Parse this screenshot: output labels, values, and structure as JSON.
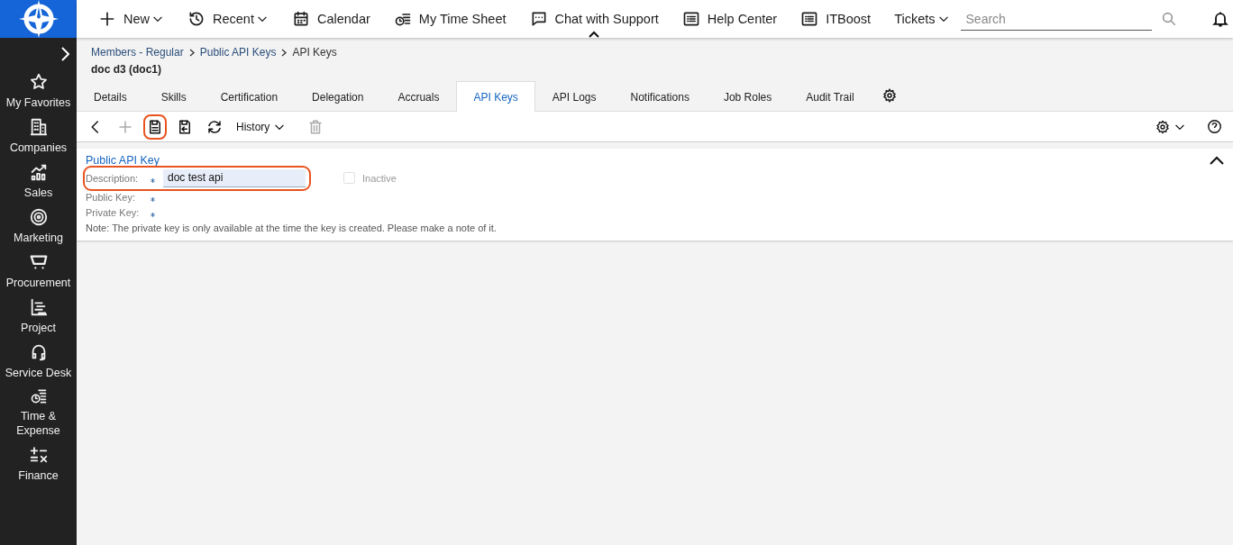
{
  "sidebar": {
    "items": [
      {
        "label": "My Favorites"
      },
      {
        "label": "Companies"
      },
      {
        "label": "Sales"
      },
      {
        "label": "Marketing"
      },
      {
        "label": "Procurement"
      },
      {
        "label": "Project"
      },
      {
        "label": "Service Desk"
      },
      {
        "label": "Time & Expense"
      },
      {
        "label": "Finance"
      }
    ]
  },
  "topbar": {
    "menu": [
      {
        "kind": "plus",
        "label": "New",
        "dropdown": true,
        "expanded": false
      },
      {
        "kind": "history",
        "label": "Recent",
        "dropdown": true,
        "expanded": false
      },
      {
        "kind": "calendar",
        "label": "Calendar",
        "dropdown": false,
        "expanded": false
      },
      {
        "kind": "timesheet",
        "label": "My Time Sheet",
        "dropdown": false,
        "expanded": false
      },
      {
        "kind": "chat",
        "label": "Chat with Support",
        "dropdown": false,
        "expanded": true
      },
      {
        "kind": "list",
        "label": "Help Center",
        "dropdown": false,
        "expanded": false
      },
      {
        "kind": "list",
        "label": "ITBoost",
        "dropdown": false,
        "expanded": false
      },
      {
        "kind": "none",
        "label": "Tickets",
        "dropdown": true,
        "expanded": false
      }
    ],
    "search": {
      "placeholder": "Search"
    }
  },
  "breadcrumb": [
    "Members - Regular",
    "Public API Keys",
    "API Keys"
  ],
  "record_title": "doc d3 (doc1)",
  "tabs": [
    {
      "label": "Details",
      "selected": false
    },
    {
      "label": "Skills",
      "selected": false
    },
    {
      "label": "Certification",
      "selected": false
    },
    {
      "label": "Delegation",
      "selected": false
    },
    {
      "label": "Accruals",
      "selected": false
    },
    {
      "label": "API Keys",
      "selected": true
    },
    {
      "label": "API Logs",
      "selected": false
    },
    {
      "label": "Notifications",
      "selected": false
    },
    {
      "label": "Job Roles",
      "selected": false
    },
    {
      "label": "Audit Trail",
      "selected": false
    }
  ],
  "toolbar": {
    "buttons": [
      {
        "kind": "back",
        "disabled": false,
        "highlighted": false
      },
      {
        "kind": "add",
        "disabled": true,
        "highlighted": false
      },
      {
        "kind": "save",
        "disabled": false,
        "highlighted": true
      },
      {
        "kind": "save-close",
        "disabled": false,
        "highlighted": false
      },
      {
        "kind": "refresh",
        "disabled": false,
        "highlighted": false
      },
      {
        "kind": "history",
        "label": "History",
        "disabled": false,
        "highlighted": false
      },
      {
        "kind": "delete",
        "disabled": true,
        "highlighted": false
      }
    ]
  },
  "form": {
    "section_title": "Public API Key",
    "expanded": true,
    "fields": [
      {
        "label": "Description:",
        "required": true,
        "value": "doc test api",
        "highlighted": true
      },
      {
        "label": "Public Key:",
        "required": true,
        "highlighted": false
      },
      {
        "label": "Private Key:",
        "required": true,
        "highlighted": false
      }
    ],
    "inactive": {
      "label": "Inactive",
      "checked": false,
      "disabled": true
    },
    "note": "Note: The private key is only available at the time the key is created. Please make a note of it."
  }
}
